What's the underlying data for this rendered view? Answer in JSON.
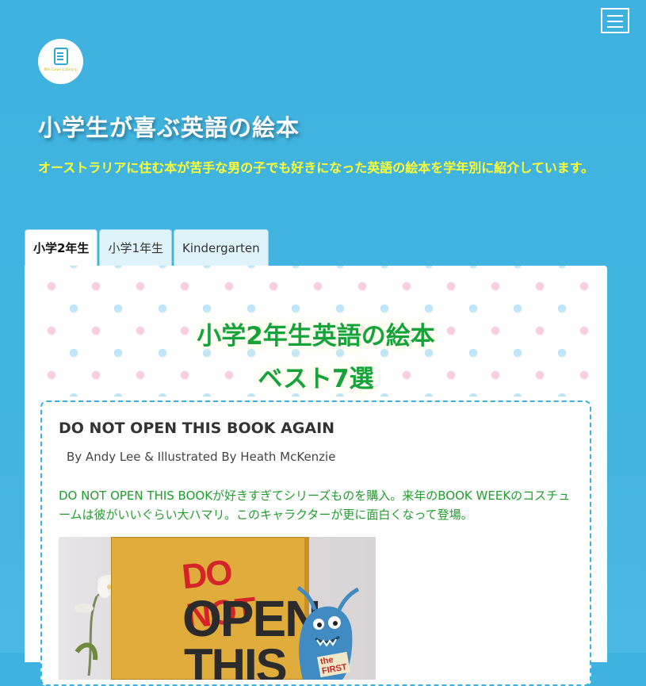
{
  "header": {
    "menu_icon": "hamburger-menu-icon",
    "logo_icon": "book-icon",
    "logo_text": "We Love Library",
    "site_title": "小学生が喜ぶ英語の絵本",
    "tagline": "オーストラリアに住む本が苦手な男の子でも好きになった英語の絵本を学年別に紹介しています。"
  },
  "tabs": [
    {
      "label": "小学2年生",
      "active": true
    },
    {
      "label": "小学1年生",
      "active": false
    },
    {
      "label": "Kindergarten",
      "active": false
    }
  ],
  "hero": {
    "title_line1": "小学2年生英語の絵本",
    "title_line2": "ベスト7選"
  },
  "book": {
    "title": "DO NOT OPEN THIS BOOK AGAIN",
    "author": "By Andy Lee & Illustrated By Heath McKenzie",
    "description": "DO NOT OPEN THIS BOOKが好きすぎてシリーズものを購入。来年のBOOK WEEKのコスチュームは彼がいいぐらい大ハマリ。このキャラクターが更に面白くなって登場。",
    "cover": {
      "word1": "DO NOT",
      "word2": "OPEN",
      "word3": "THIS",
      "sign": "the FIRST"
    }
  },
  "colors": {
    "background": "#42b4e0",
    "tagline": "#ffff33",
    "hero_title": "#16a33a",
    "card_border": "#3cb0de",
    "description": "#1f9e2c"
  }
}
